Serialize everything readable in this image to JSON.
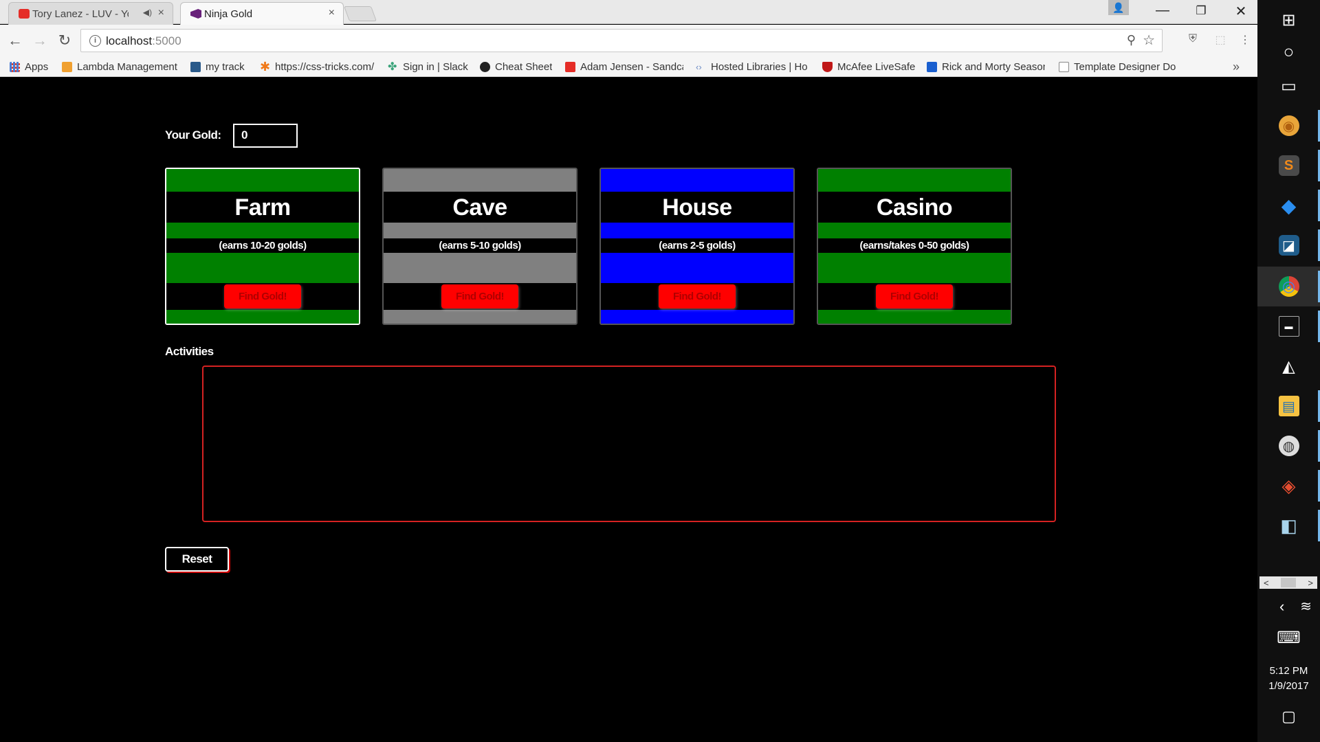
{
  "browser": {
    "tabs": [
      {
        "title": "Tory Lanez - LUV - YouTube",
        "favicon": "youtube-icon",
        "audio_icon": "speaker-icon",
        "close": "×"
      },
      {
        "title": "Ninja Gold",
        "favicon": "visual-studio-icon",
        "close": "×"
      }
    ],
    "window_controls": {
      "minimize": "—",
      "restore": "❐",
      "close": "✕"
    },
    "profile_icon": "👤",
    "nav": {
      "back": "←",
      "forward": "→",
      "reload": "↻"
    },
    "address": {
      "host": "localhost",
      "port": ":5000",
      "info": "i",
      "zoom": "⚲",
      "star": "☆"
    },
    "extensions": [
      "⛨",
      "⬚",
      "⋮"
    ],
    "bookmarks": [
      {
        "label": "Apps",
        "color": "#4a7bd4"
      },
      {
        "label": "Lambda Management",
        "color": "#f0a030"
      },
      {
        "label": "my track",
        "color": "#2a5a8a"
      },
      {
        "label": "https://css-tricks.com/",
        "color": "#f07a1a"
      },
      {
        "label": "Sign in | Slack",
        "color": "#3aa37a"
      },
      {
        "label": "Cheat Sheet",
        "color": "#222222"
      },
      {
        "label": "Adam Jensen - Sandcastle",
        "color": "#e52d27"
      },
      {
        "label": "Hosted Libraries | Ho",
        "color": "#6a8ac4"
      },
      {
        "label": "McAfee LiveSafe",
        "color": "#c01818"
      },
      {
        "label": "Rick and Morty Season",
        "color": "#1a5fcf"
      },
      {
        "label": "Template Designer Do",
        "color": "#888888"
      }
    ],
    "bookmarks_more": "»"
  },
  "page": {
    "gold_label": "Your Gold:",
    "gold_value": "0",
    "cards": [
      {
        "title": "Farm",
        "desc": "(earns 10-20 golds)",
        "button": "Find Gold!",
        "color": "#008000"
      },
      {
        "title": "Cave",
        "desc": "(earns 5-10 golds)",
        "button": "Find Gold!",
        "color": "#808080"
      },
      {
        "title": "House",
        "desc": "(earns 2-5 golds)",
        "button": "Find Gold!",
        "color": "#0000ff"
      },
      {
        "title": "Casino",
        "desc": "(earns/takes 0-50 golds)",
        "button": "Find Gold!",
        "color": "#008000"
      }
    ],
    "activities_label": "Activities",
    "reset_label": "Reset"
  },
  "taskbar": {
    "items": [
      {
        "icon": "windows-start-icon",
        "glyph": "⊞"
      },
      {
        "icon": "cortana-icon",
        "glyph": "○"
      },
      {
        "icon": "task-view-icon",
        "glyph": "▭"
      },
      {
        "icon": "basketball-app-icon",
        "glyph": "◉"
      },
      {
        "icon": "sublime-text-icon",
        "glyph": "S"
      },
      {
        "icon": "vscode-icon",
        "glyph": "◆"
      },
      {
        "icon": "mysql-workbench-icon",
        "glyph": "◪"
      },
      {
        "icon": "chrome-icon",
        "glyph": "◎"
      },
      {
        "icon": "terminal-icon",
        "glyph": "▬"
      },
      {
        "icon": "unity-icon",
        "glyph": "◭"
      },
      {
        "icon": "file-explorer-icon",
        "glyph": "▤"
      },
      {
        "icon": "github-icon",
        "glyph": "◍"
      },
      {
        "icon": "git-icon",
        "glyph": "◈"
      },
      {
        "icon": "eraser-app-icon",
        "glyph": "◧"
      }
    ],
    "scroll_left": "<",
    "scroll_right": ">",
    "tray_chevron": "‹",
    "wifi": "≋",
    "keyboard": "⌨",
    "time": "5:12 PM",
    "date": "1/9/2017",
    "notifications": "▢"
  }
}
